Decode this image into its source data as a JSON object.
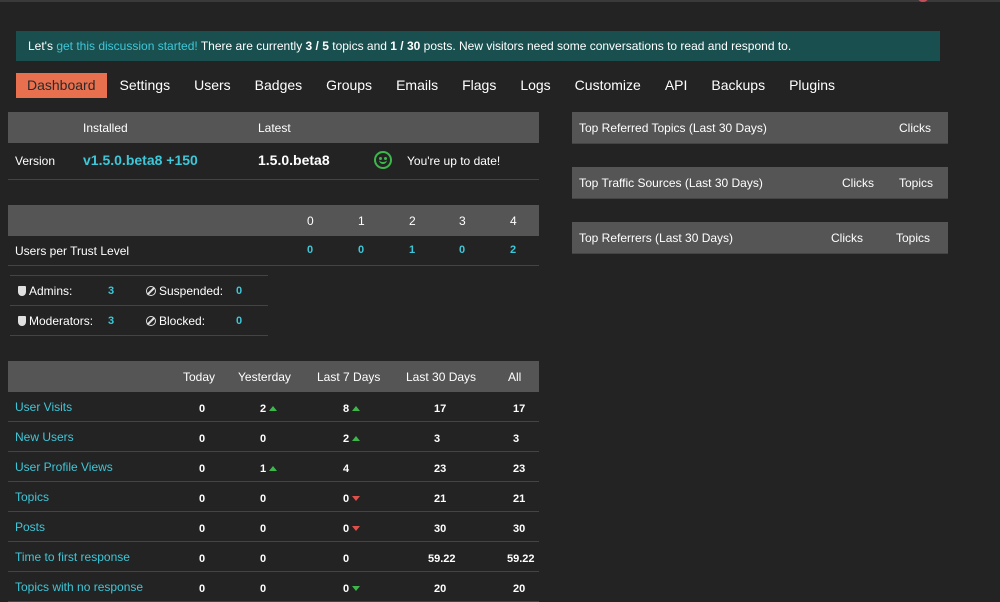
{
  "notice": {
    "prefix": "Let's ",
    "link": "get this discussion started!",
    "part1": " There are currently ",
    "topics": "3 / 5",
    "part2": " topics and ",
    "posts": "1 / 30",
    "part3": " posts. New visitors need some conversations to read and respond to."
  },
  "nav": [
    "Dashboard",
    "Settings",
    "Users",
    "Badges",
    "Groups",
    "Emails",
    "Flags",
    "Logs",
    "Customize",
    "API",
    "Backups",
    "Plugins"
  ],
  "version": {
    "installed_header": "Installed",
    "latest_header": "Latest",
    "label": "Version",
    "installed": "v1.5.0.beta8 +150",
    "latest": "1.5.0.beta8",
    "status": "You're up to date!"
  },
  "trust": {
    "levels": [
      "0",
      "1",
      "2",
      "3",
      "4"
    ],
    "label": "Users per Trust Level",
    "values": [
      "0",
      "0",
      "1",
      "0",
      "2"
    ]
  },
  "staff": {
    "admins_label": "Admins:",
    "admins": "3",
    "suspended_label": "Suspended:",
    "suspended": "0",
    "moderators_label": "Moderators:",
    "moderators": "3",
    "blocked_label": "Blocked:",
    "blocked": "0"
  },
  "stats": {
    "headers": [
      "Today",
      "Yesterday",
      "Last 7 Days",
      "Last 30 Days",
      "All"
    ],
    "rows": [
      {
        "label": "User Visits",
        "today": "0",
        "yesterday": "2",
        "y_trend": "up",
        "week": "8",
        "w_trend": "up",
        "month": "17",
        "all": "17"
      },
      {
        "label": "New Users",
        "today": "0",
        "yesterday": "0",
        "y_trend": "",
        "week": "2",
        "w_trend": "up",
        "month": "3",
        "all": "3"
      },
      {
        "label": "User Profile Views",
        "today": "0",
        "yesterday": "1",
        "y_trend": "up",
        "week": "4",
        "w_trend": "",
        "month": "23",
        "all": "23"
      },
      {
        "label": "Topics",
        "today": "0",
        "yesterday": "0",
        "y_trend": "",
        "week": "0",
        "w_trend": "down-red",
        "month": "21",
        "all": "21"
      },
      {
        "label": "Posts",
        "today": "0",
        "yesterday": "0",
        "y_trend": "",
        "week": "0",
        "w_trend": "down-red",
        "month": "30",
        "all": "30"
      },
      {
        "label": "Time to first response",
        "today": "0",
        "yesterday": "0",
        "y_trend": "",
        "week": "0",
        "w_trend": "",
        "month": "59.22",
        "all": "59.22"
      },
      {
        "label": "Topics with no response",
        "today": "0",
        "yesterday": "0",
        "y_trend": "",
        "week": "0",
        "w_trend": "down-green",
        "month": "20",
        "all": "20"
      }
    ]
  },
  "right": {
    "referred_topics": "Top Referred Topics (Last 30 Days)",
    "referred_clicks": "Clicks",
    "traffic_sources": "Top Traffic Sources (Last 30 Days)",
    "traffic_clicks": "Clicks",
    "traffic_topics": "Topics",
    "referrers": "Top Referrers (Last 30 Days)",
    "referrers_clicks": "Clicks",
    "referrers_topics": "Topics"
  },
  "colors": {
    "accent": "#e8704f",
    "teal": "#3ec7d8",
    "notice_bg": "#19504f",
    "header_bg": "#555555",
    "up": "#3cb84a",
    "down": "#e0504a"
  }
}
